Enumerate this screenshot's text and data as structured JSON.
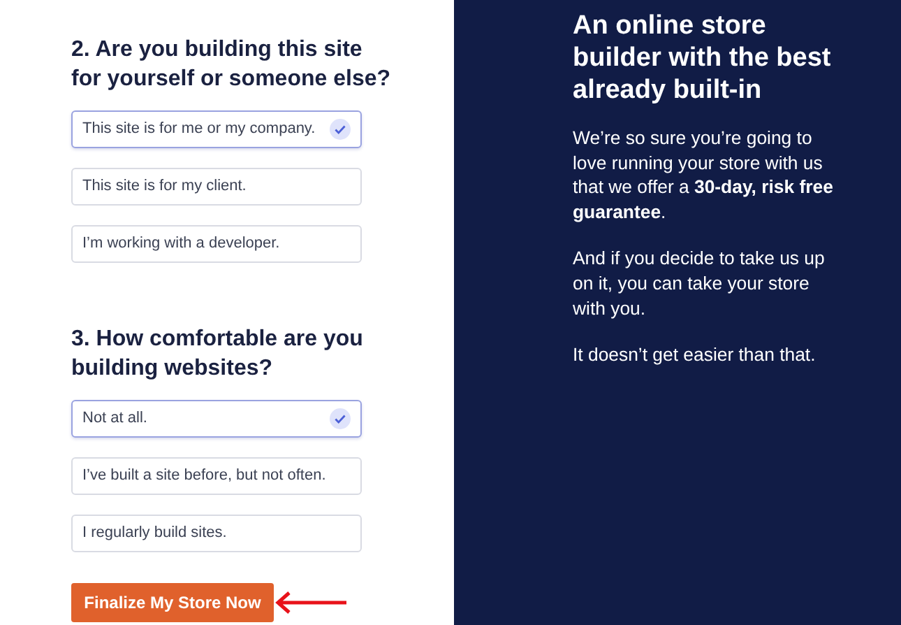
{
  "questions": [
    {
      "title": "2. Are you building this site for yourself or someone else?",
      "options": [
        {
          "label": "This site is for me or my company.",
          "selected": true
        },
        {
          "label": "This site is for my client.",
          "selected": false
        },
        {
          "label": "I’m working with a developer.",
          "selected": false
        }
      ]
    },
    {
      "title": "3. How comfortable are you building websites?",
      "options": [
        {
          "label": "Not at all.",
          "selected": true
        },
        {
          "label": "I’ve built a site before, but not often.",
          "selected": false
        },
        {
          "label": "I regularly build sites.",
          "selected": false
        }
      ]
    }
  ],
  "submit_button": "Finalize My Store Now",
  "aside": {
    "title": "An online store builder with the best already built-in",
    "paragraphs": [
      "We’re so sure you’re going to love running your store with us that we offer a **30-day, risk free guarantee**.",
      "And if you decide to take us up on it, you can take your store with you.",
      "It doesn’t get easier than that."
    ]
  }
}
